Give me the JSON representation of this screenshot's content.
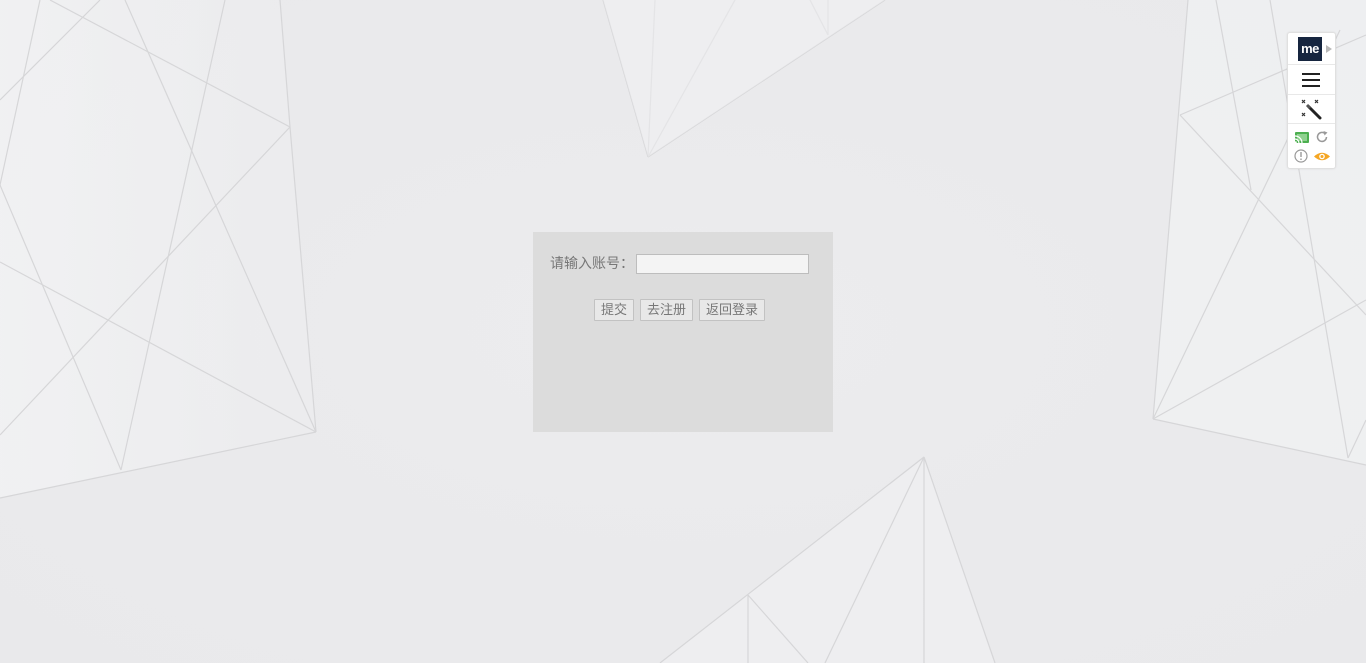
{
  "form": {
    "account_label": "请输入账号：",
    "account_value": "",
    "account_placeholder": "",
    "submit_label": "提交",
    "register_label": "去注册",
    "back_login_label": "返回登录"
  },
  "toolbar": {
    "logo_text": "me",
    "icons": [
      "menu-icon",
      "magic-wand-icon",
      "cast-icon",
      "refresh-icon",
      "info-icon",
      "eye-icon"
    ]
  },
  "colors": {
    "background": "#ececee",
    "panel": "#dcdcdc",
    "logo_bg": "#16253f",
    "cast_green": "#4caf50",
    "eye_orange": "#f5a623"
  }
}
